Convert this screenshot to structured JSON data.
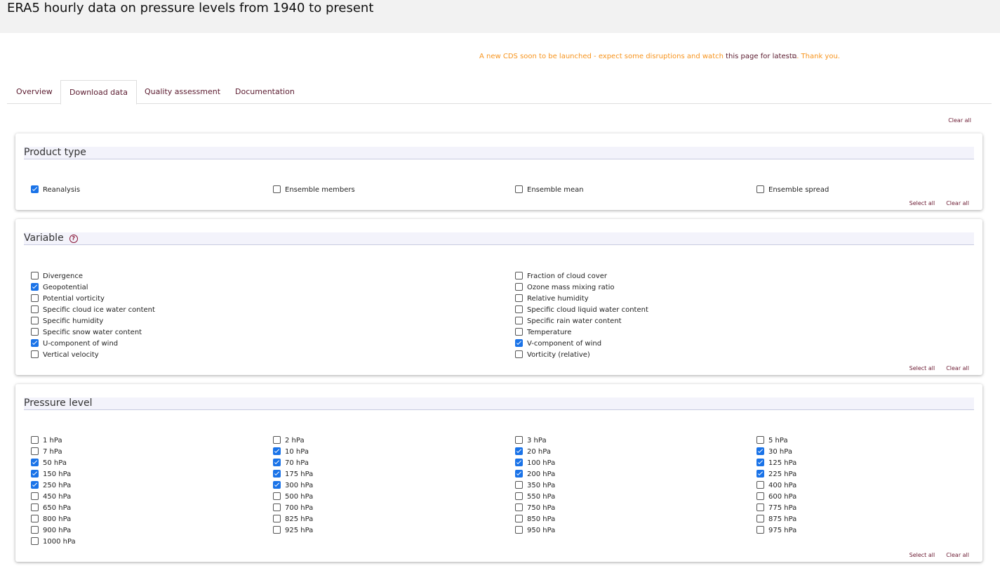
{
  "page_title": "ERA5 hourly data on pressure levels from 1940 to present",
  "notice": {
    "text": "A new CDS soon to be launched - expect some disruptions and watch ",
    "link": "this page for latest",
    "ext_icon": "external-link-icon",
    "ext_glyph": "⧉",
    "suffix": ". Thank you."
  },
  "tabs": [
    "Overview",
    "Download data",
    "Quality assessment",
    "Documentation"
  ],
  "active_tab": "Download data",
  "clear_all_label": "Clear all",
  "select_all_label": "Select all",
  "colors": {
    "accent": "#f7941d",
    "link": "#5a1a2e",
    "checkbox": "#1a73e8"
  },
  "sections": {
    "product_type": {
      "title": "Product type",
      "options": [
        {
          "label": "Reanalysis",
          "checked": true
        },
        {
          "label": "Ensemble members",
          "checked": false
        },
        {
          "label": "Ensemble mean",
          "checked": false
        },
        {
          "label": "Ensemble spread",
          "checked": false
        }
      ]
    },
    "variable": {
      "title": "Variable",
      "help_icon": "help-circle-icon",
      "help_glyph": "?",
      "options": [
        {
          "label": "Divergence",
          "checked": false
        },
        {
          "label": "Fraction of cloud cover",
          "checked": false
        },
        {
          "label": "Geopotential",
          "checked": true
        },
        {
          "label": "Ozone mass mixing ratio",
          "checked": false
        },
        {
          "label": "Potential vorticity",
          "checked": false
        },
        {
          "label": "Relative humidity",
          "checked": false
        },
        {
          "label": "Specific cloud ice water content",
          "checked": false
        },
        {
          "label": "Specific cloud liquid water content",
          "checked": false
        },
        {
          "label": "Specific humidity",
          "checked": false
        },
        {
          "label": "Specific rain water content",
          "checked": false
        },
        {
          "label": "Specific snow water content",
          "checked": false
        },
        {
          "label": "Temperature",
          "checked": false
        },
        {
          "label": "U-component of wind",
          "checked": true
        },
        {
          "label": "V-component of wind",
          "checked": true
        },
        {
          "label": "Vertical velocity",
          "checked": false
        },
        {
          "label": "Vorticity (relative)",
          "checked": false
        }
      ]
    },
    "pressure_level": {
      "title": "Pressure level",
      "options": [
        {
          "label": "1 hPa",
          "checked": false
        },
        {
          "label": "2 hPa",
          "checked": false
        },
        {
          "label": "3 hPa",
          "checked": false
        },
        {
          "label": "5 hPa",
          "checked": false
        },
        {
          "label": "7 hPa",
          "checked": false
        },
        {
          "label": "10 hPa",
          "checked": true
        },
        {
          "label": "20 hPa",
          "checked": true
        },
        {
          "label": "30 hPa",
          "checked": true
        },
        {
          "label": "50 hPa",
          "checked": true
        },
        {
          "label": "70 hPa",
          "checked": true
        },
        {
          "label": "100 hPa",
          "checked": true
        },
        {
          "label": "125 hPa",
          "checked": true
        },
        {
          "label": "150 hPa",
          "checked": true
        },
        {
          "label": "175 hPa",
          "checked": true
        },
        {
          "label": "200 hPa",
          "checked": true
        },
        {
          "label": "225 hPa",
          "checked": true
        },
        {
          "label": "250 hPa",
          "checked": true
        },
        {
          "label": "300 hPa",
          "checked": true
        },
        {
          "label": "350 hPa",
          "checked": false
        },
        {
          "label": "400 hPa",
          "checked": false
        },
        {
          "label": "450 hPa",
          "checked": false
        },
        {
          "label": "500 hPa",
          "checked": false
        },
        {
          "label": "550 hPa",
          "checked": false
        },
        {
          "label": "600 hPa",
          "checked": false
        },
        {
          "label": "650 hPa",
          "checked": false
        },
        {
          "label": "700 hPa",
          "checked": false
        },
        {
          "label": "750 hPa",
          "checked": false
        },
        {
          "label": "775 hPa",
          "checked": false
        },
        {
          "label": "800 hPa",
          "checked": false
        },
        {
          "label": "825 hPa",
          "checked": false
        },
        {
          "label": "850 hPa",
          "checked": false
        },
        {
          "label": "875 hPa",
          "checked": false
        },
        {
          "label": "900 hPa",
          "checked": false
        },
        {
          "label": "925 hPa",
          "checked": false
        },
        {
          "label": "950 hPa",
          "checked": false
        },
        {
          "label": "975 hPa",
          "checked": false
        },
        {
          "label": "1000 hPa",
          "checked": false
        }
      ]
    }
  }
}
